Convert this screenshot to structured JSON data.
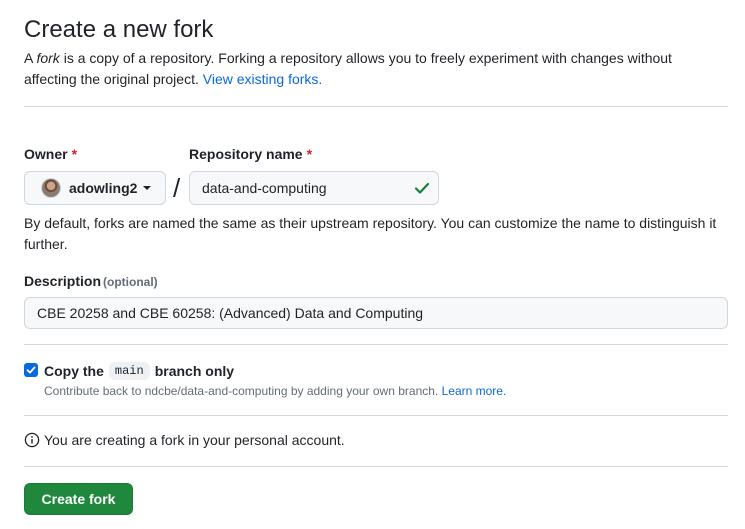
{
  "header": {
    "title": "Create a new fork",
    "intro_prefix": "A ",
    "intro_fork_word": "fork",
    "intro_text": " is a copy of a repository. Forking a repository allows you to freely experiment with changes without affecting the original project. ",
    "intro_link": "View existing forks."
  },
  "owner": {
    "label": "Owner",
    "required_mark": "*",
    "value": "adowling2"
  },
  "repository": {
    "label": "Repository name",
    "required_mark": "*",
    "separator": "/",
    "value": "data-and-computing",
    "valid_icon": "check-icon"
  },
  "helper_text": "By default, forks are named the same as their upstream repository. You can customize the name to distinguish it further.",
  "description": {
    "label": "Description",
    "optional_text": "(optional)",
    "value": "CBE 20258 and CBE 60258: (Advanced) Data and Computing"
  },
  "copy_branch": {
    "checked": true,
    "label_prefix": "Copy the",
    "branch_name": "main",
    "label_suffix": "branch only",
    "note": "Contribute back to ndcbe/data-and-computing by adding your own branch.",
    "note_link": "Learn more."
  },
  "info": {
    "icon": "info-icon",
    "text": "You are creating a fork in your personal account."
  },
  "actions": {
    "create_label": "Create fork"
  },
  "colors": {
    "link": "#0969da",
    "required": "#cf222e",
    "primary_button": "#1f883d",
    "check": "#1a7f37",
    "checkbox": "#0969da"
  }
}
